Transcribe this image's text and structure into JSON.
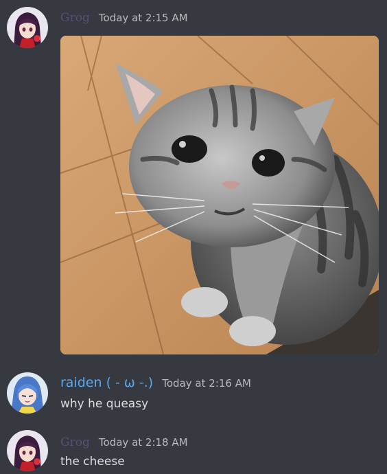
{
  "messages": [
    {
      "username": "Grog",
      "timestamp": "Today at 2:15 AM",
      "avatar": "anime-girl-red-avatar",
      "attachment": "sad-tabby-cat-photo"
    },
    {
      "username": "raiden ( - ω -.)",
      "timestamp": "Today at 2:16 AM",
      "avatar": "anime-girl-blue-hair-avatar",
      "text": "why he queasy"
    },
    {
      "username": "Grog",
      "timestamp": "Today at 2:18 AM",
      "avatar": "anime-girl-red-avatar",
      "text": "the cheese"
    }
  ],
  "colors": {
    "background": "#36393f",
    "username_faded": "#5a4f73",
    "username_blue": "#5aa9f0",
    "timestamp": "#b9bbbe",
    "text": "#dcddde"
  }
}
